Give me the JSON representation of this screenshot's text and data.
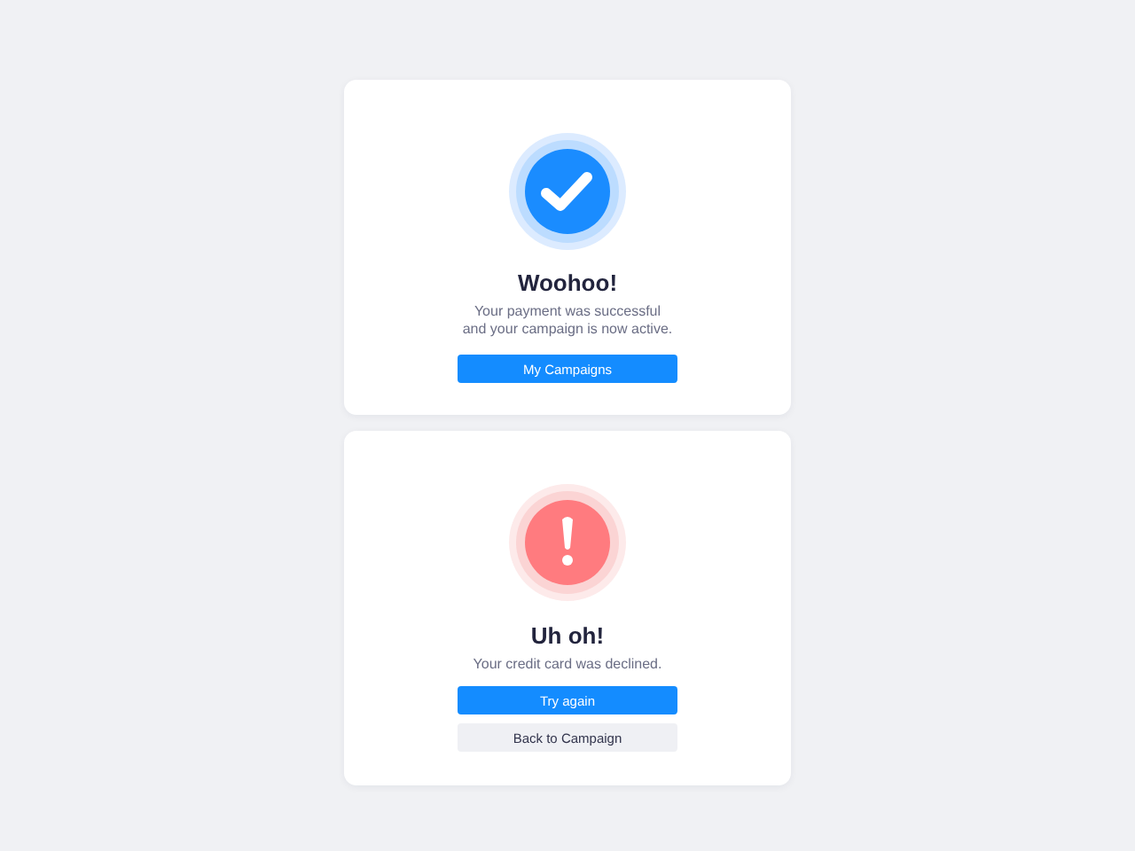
{
  "cards": [
    {
      "kind": "success",
      "title": "Woohoo!",
      "message": "Your payment was successful\nand your campaign is now active.",
      "buttons": [
        {
          "label": "My Campaigns",
          "kind": "primary"
        }
      ]
    },
    {
      "kind": "error",
      "title": "Uh oh!",
      "message": "Your credit card was declined.",
      "buttons": [
        {
          "label": "Try again",
          "kind": "primary"
        },
        {
          "label": "Back to Campaign",
          "kind": "secondary"
        }
      ]
    }
  ]
}
